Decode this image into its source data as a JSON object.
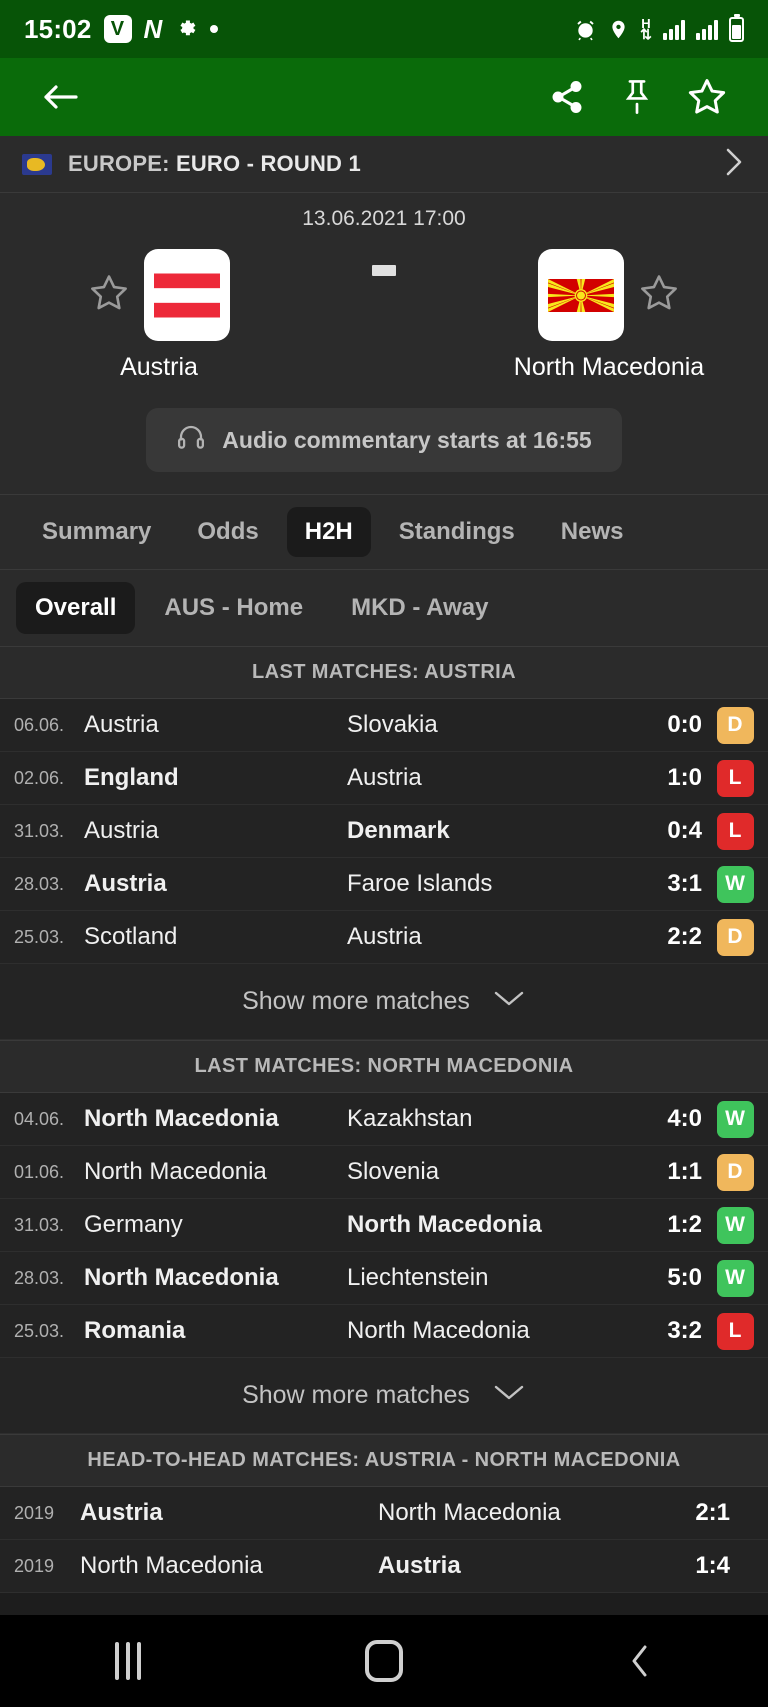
{
  "statusbar": {
    "time": "15:02",
    "icons": [
      "v-app-icon",
      "n-app-icon",
      "gear-icon",
      "dot-icon"
    ],
    "right_icons": [
      "alarm-icon",
      "location-icon",
      "hspa-data-icon",
      "signal-bars-icon",
      "signal-bars-2-icon",
      "battery-icon"
    ],
    "network_label": "H",
    "brand_green": "#075407"
  },
  "appbar": {
    "back_icon": "back-arrow-icon",
    "share_icon": "share-icon",
    "pin_icon": "pin-icon",
    "star_icon": "star-icon",
    "bar_green": "#0a6b0a"
  },
  "league": {
    "region": "EUROPE:",
    "name": "EURO - ROUND 1",
    "flag_icon": "europe-flag-icon",
    "chevron": "chevron-right-icon"
  },
  "match": {
    "kickoff": "13.06.2021 17:00",
    "separator": "-",
    "home": {
      "name": "Austria",
      "flag": "austria-flag",
      "star": "star-outline-icon"
    },
    "away": {
      "name": "North Macedonia",
      "flag": "north-macedonia-flag",
      "star": "star-outline-icon"
    },
    "audio_commentary": "Audio commentary starts at 16:55",
    "audio_icon": "headphones-icon"
  },
  "tabs": [
    {
      "label": "Summary",
      "active": false
    },
    {
      "label": "Odds",
      "active": false
    },
    {
      "label": "H2H",
      "active": true
    },
    {
      "label": "Standings",
      "active": false
    },
    {
      "label": "News",
      "active": false
    }
  ],
  "subtabs": [
    {
      "label": "Overall",
      "active": true
    },
    {
      "label": "AUS - Home",
      "active": false
    },
    {
      "label": "MKD - Away",
      "active": false
    }
  ],
  "sections": [
    {
      "title": "LAST MATCHES: AUSTRIA",
      "show_more": "Show more matches",
      "rows": [
        {
          "date": "06.06.",
          "home": "Austria",
          "home_bold": false,
          "away": "Slovakia",
          "away_bold": false,
          "score": "0:0",
          "badge": "D"
        },
        {
          "date": "02.06.",
          "home": "England",
          "home_bold": true,
          "away": "Austria",
          "away_bold": false,
          "score": "1:0",
          "badge": "L"
        },
        {
          "date": "31.03.",
          "home": "Austria",
          "home_bold": false,
          "away": "Denmark",
          "away_bold": true,
          "score": "0:4",
          "badge": "L"
        },
        {
          "date": "28.03.",
          "home": "Austria",
          "home_bold": true,
          "away": "Faroe Islands",
          "away_bold": false,
          "score": "3:1",
          "badge": "W"
        },
        {
          "date": "25.03.",
          "home": "Scotland",
          "home_bold": false,
          "away": "Austria",
          "away_bold": false,
          "score": "2:2",
          "badge": "D"
        }
      ]
    },
    {
      "title": "LAST MATCHES: NORTH MACEDONIA",
      "show_more": "Show more matches",
      "rows": [
        {
          "date": "04.06.",
          "home": "North Macedonia",
          "home_bold": true,
          "away": "Kazakhstan",
          "away_bold": false,
          "score": "4:0",
          "badge": "W"
        },
        {
          "date": "01.06.",
          "home": "North Macedonia",
          "home_bold": false,
          "away": "Slovenia",
          "away_bold": false,
          "score": "1:1",
          "badge": "D"
        },
        {
          "date": "31.03.",
          "home": "Germany",
          "home_bold": false,
          "away": "North Macedonia",
          "away_bold": true,
          "score": "1:2",
          "badge": "W"
        },
        {
          "date": "28.03.",
          "home": "North Macedonia",
          "home_bold": true,
          "away": "Liechtenstein",
          "away_bold": false,
          "score": "5:0",
          "badge": "W"
        },
        {
          "date": "25.03.",
          "home": "Romania",
          "home_bold": true,
          "away": "North Macedonia",
          "away_bold": false,
          "score": "3:2",
          "badge": "L"
        }
      ]
    },
    {
      "title": "HEAD-TO-HEAD MATCHES: AUSTRIA - NORTH MACEDONIA",
      "show_more": null,
      "rows": [
        {
          "date": "2019",
          "home": "Austria",
          "home_bold": true,
          "away": "North Macedonia",
          "away_bold": false,
          "score": "2:1",
          "badge": null
        },
        {
          "date": "2019",
          "home": "North Macedonia",
          "home_bold": false,
          "away": "Austria",
          "away_bold": true,
          "score": "1:4",
          "badge": null
        }
      ]
    }
  ],
  "navbar": {
    "recents_icon": "recents-icon",
    "home_icon": "home-icon",
    "back_icon": "nav-back-icon"
  },
  "colors": {
    "win": "#3fc45c",
    "loss": "#e02a2a",
    "draw": "#f0b75c"
  }
}
